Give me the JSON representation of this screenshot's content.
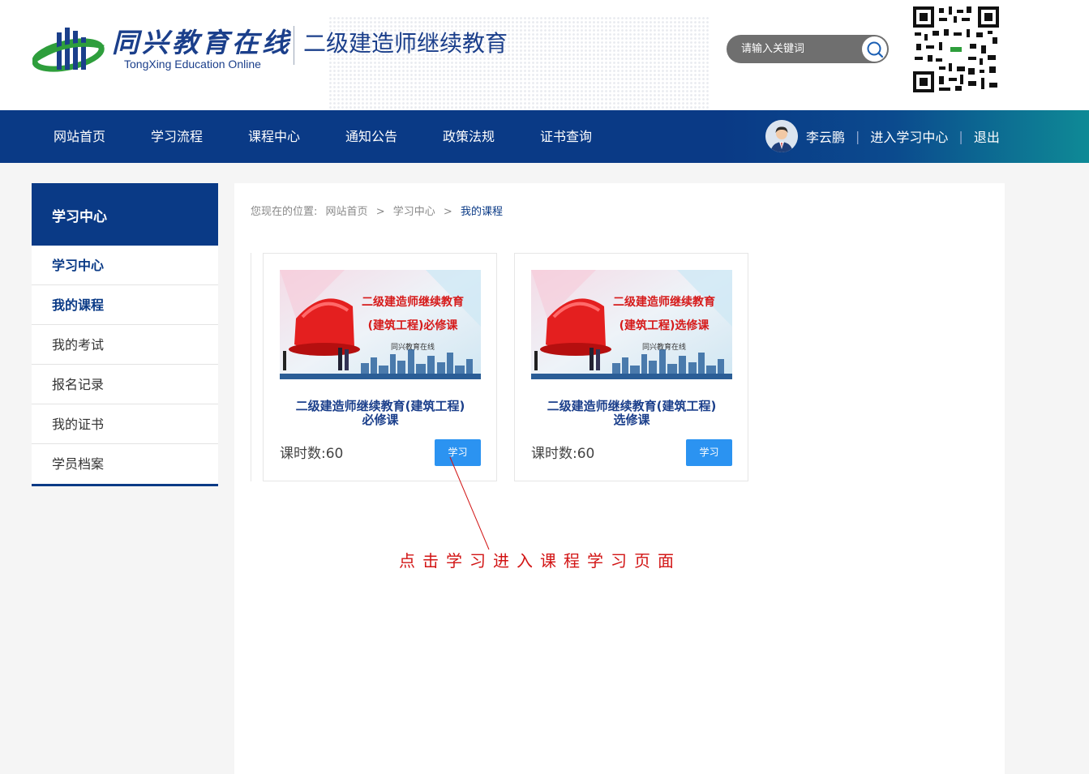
{
  "header": {
    "logo_cn": "同兴教育在线",
    "logo_en": "TongXing Education Online",
    "site_title": "二级建造师继续教育",
    "search_placeholder": "请输入关键词",
    "search_icon": "search-icon",
    "qr_icon": "qr-code"
  },
  "nav": {
    "items": [
      "网站首页",
      "学习流程",
      "课程中心",
      "通知公告",
      "政策法规",
      "证书查询"
    ],
    "user_name": "李云鹏",
    "sep": "|",
    "enter_center": "进入学习中心",
    "logout": "退出"
  },
  "sidebar": {
    "title": "学习中心",
    "items": [
      {
        "label": "学习中心"
      },
      {
        "label": "我的课程",
        "active": true
      },
      {
        "label": "我的考试"
      },
      {
        "label": "报名记录"
      },
      {
        "label": "我的证书"
      },
      {
        "label": "学员档案"
      }
    ]
  },
  "breadcrumb": {
    "prefix": "您现在的位置:",
    "home": "网站首页",
    "sep": ">",
    "center": "学习中心",
    "current": "我的课程"
  },
  "courses": [
    {
      "banner_line1": "二级建造师继续教育",
      "banner_line2": "(建筑工程)必修课",
      "banner_line3": "同兴教育在线",
      "title_line1": "二级建造师继续教育(建筑工程)",
      "title_line2": "必修课",
      "hours": "课时数:60",
      "button": "学习"
    },
    {
      "banner_line1": "二级建造师继续教育",
      "banner_line2": "(建筑工程)选修课",
      "banner_line3": "同兴教育在线",
      "title_line1": "二级建造师继续教育(建筑工程)",
      "title_line2": "选修课",
      "hours": "课时数:60",
      "button": "学习"
    }
  ],
  "annotation": "点击学习进入课程学习页面",
  "colors": {
    "brand_blue": "#0a3a86",
    "button_blue": "#2b93f1",
    "annotation_red": "#d21414"
  }
}
